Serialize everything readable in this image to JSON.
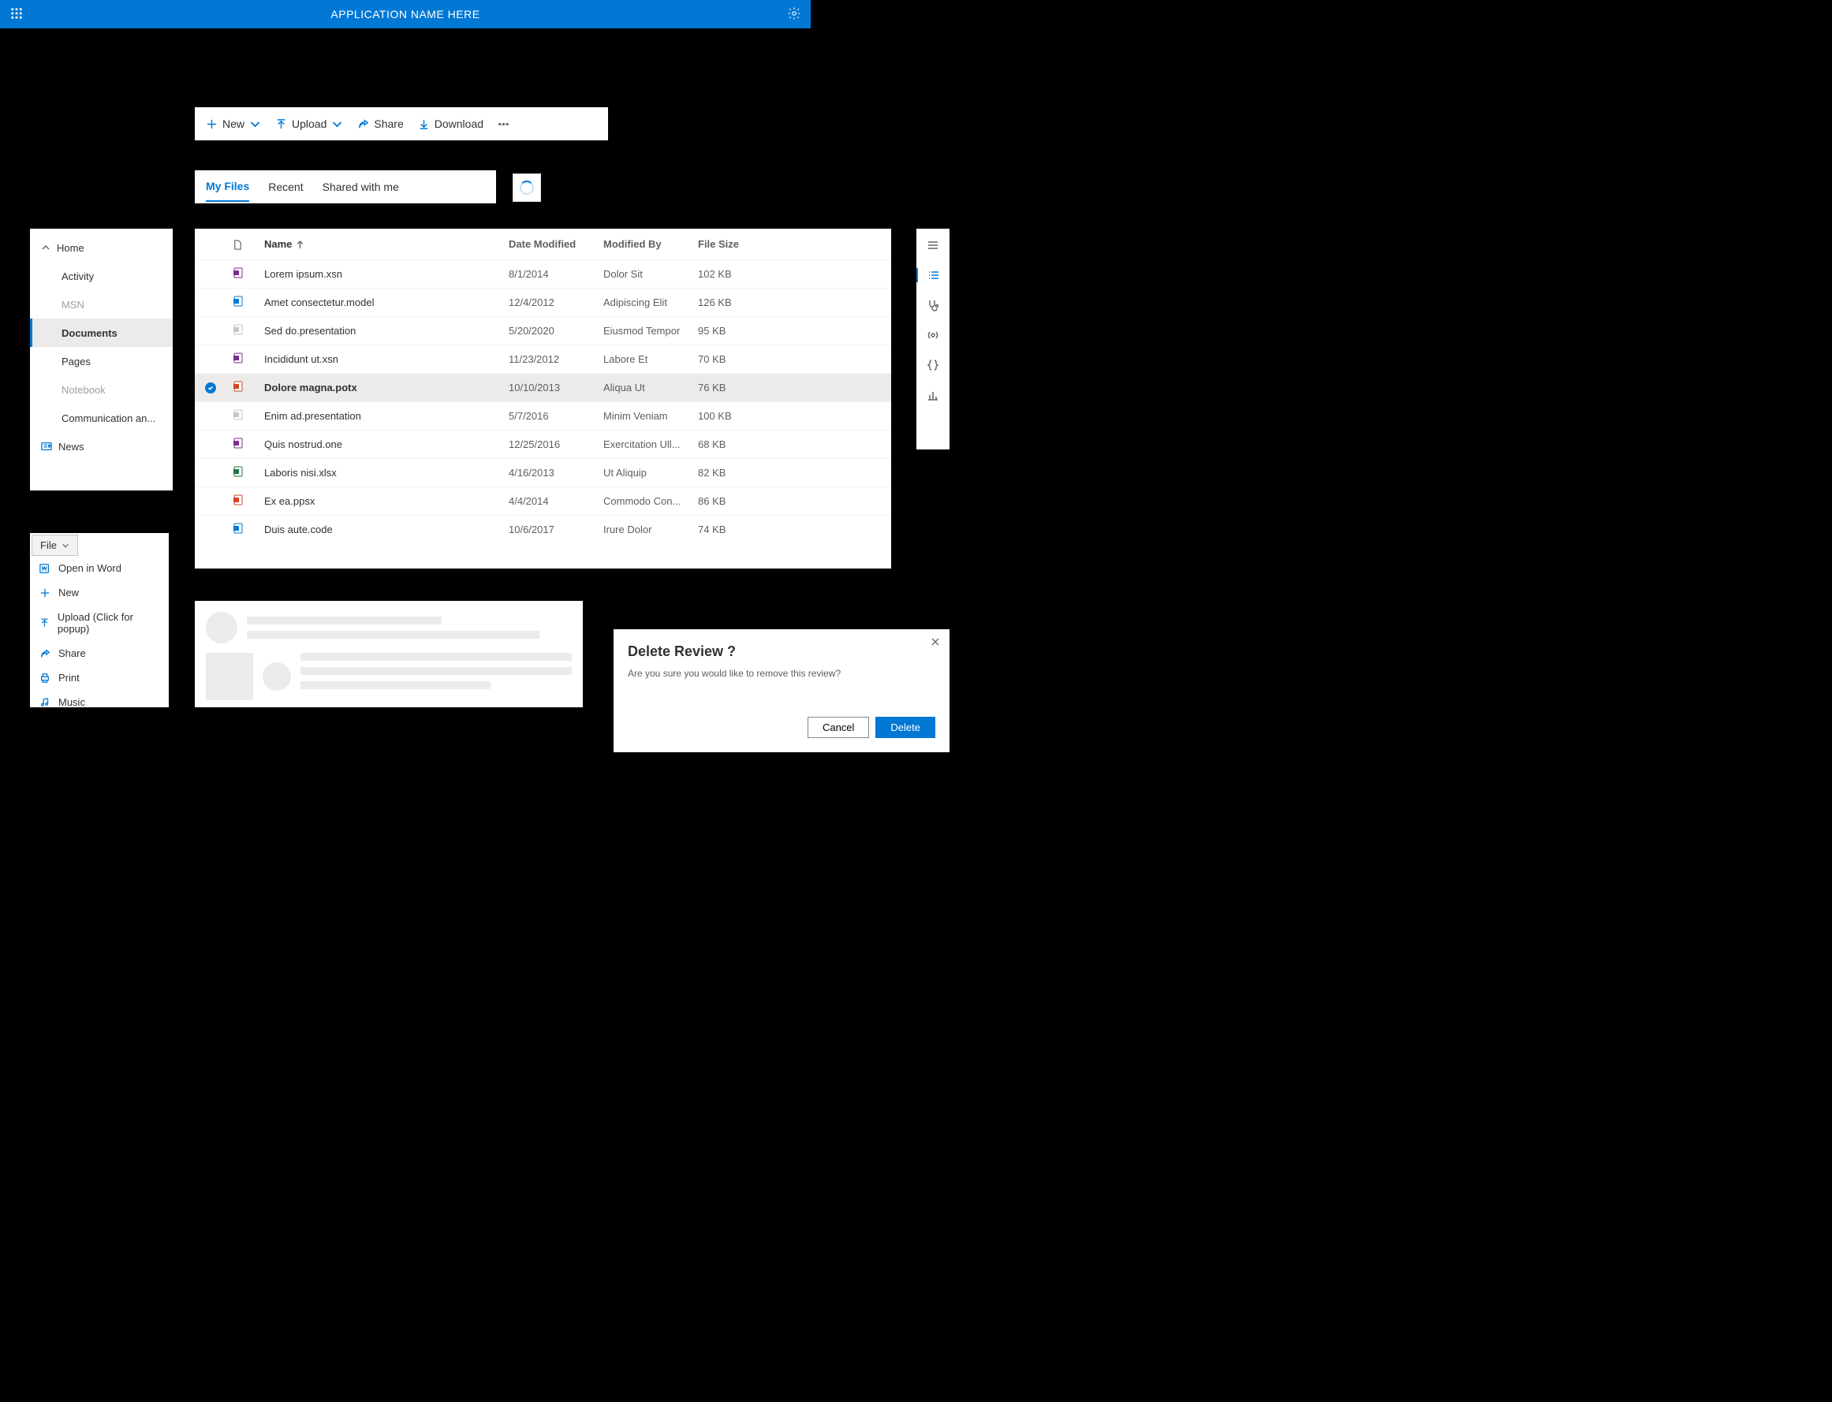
{
  "header": {
    "title": "APPLICATION NAME HERE"
  },
  "commandbar": {
    "new": "New",
    "upload": "Upload",
    "share": "Share",
    "download": "Download"
  },
  "tabs": {
    "t0": "My Files",
    "t1": "Recent",
    "t2": "Shared with me",
    "active": 0
  },
  "nav": {
    "home": "Home",
    "items": [
      {
        "label": "Activity"
      },
      {
        "label": "MSN",
        "muted": true
      },
      {
        "label": "Documents",
        "selected": true
      },
      {
        "label": "Pages"
      },
      {
        "label": "Notebook",
        "muted": true
      },
      {
        "label": "Communication an..."
      }
    ],
    "news": "News"
  },
  "detailsList": {
    "columns": {
      "name": "Name",
      "modified": "Date Modified",
      "by": "Modified By",
      "size": "File Size"
    },
    "rows": [
      {
        "icon": "infopath",
        "name": "Lorem ipsum.xsn",
        "modified": "8/1/2014",
        "by": "Dolor Sit",
        "size": "102 KB"
      },
      {
        "icon": "model",
        "name": "Amet consectetur.model",
        "modified": "12/4/2012",
        "by": "Adipiscing Elit",
        "size": "126 KB"
      },
      {
        "icon": "presentation",
        "name": "Sed do.presentation",
        "modified": "5/20/2020",
        "by": "Eiusmod Tempor",
        "size": "95 KB"
      },
      {
        "icon": "infopath",
        "name": "Incididunt ut.xsn",
        "modified": "11/23/2012",
        "by": "Labore Et",
        "size": "70 KB"
      },
      {
        "icon": "powerpoint",
        "name": "Dolore magna.potx",
        "modified": "10/10/2013",
        "by": "Aliqua Ut",
        "size": "76 KB",
        "selected": true
      },
      {
        "icon": "presentation",
        "name": "Enim ad.presentation",
        "modified": "5/7/2016",
        "by": "Minim Veniam",
        "size": "100 KB"
      },
      {
        "icon": "onenote",
        "name": "Quis nostrud.one",
        "modified": "12/25/2016",
        "by": "Exercitation Ull...",
        "size": "68 KB"
      },
      {
        "icon": "excel",
        "name": "Laboris nisi.xlsx",
        "modified": "4/16/2013",
        "by": "Ut Aliquip",
        "size": "82 KB"
      },
      {
        "icon": "powerpoint-show",
        "name": "Ex ea.ppsx",
        "modified": "4/4/2014",
        "by": "Commodo Con...",
        "size": "86 KB"
      },
      {
        "icon": "code",
        "name": "Duis aute.code",
        "modified": "10/6/2017",
        "by": "Irure Dolor",
        "size": "74 KB"
      }
    ]
  },
  "fileMenu": {
    "header": "File",
    "items": [
      {
        "icon": "word",
        "label": "Open in Word"
      },
      {
        "icon": "plus",
        "label": "New"
      },
      {
        "icon": "upload",
        "label": "Upload (Click for popup)"
      },
      {
        "icon": "share",
        "label": "Share"
      },
      {
        "icon": "print",
        "label": "Print"
      },
      {
        "icon": "music",
        "label": "Music"
      }
    ]
  },
  "dialog": {
    "title": "Delete Review ?",
    "body": "Are you sure you would like to remove this review?",
    "cancel": "Cancel",
    "confirm": "Delete"
  },
  "fileIconColors": {
    "infopath": "#7b2e8c",
    "model": "#0078d4",
    "presentation": "#c8c6c4",
    "powerpoint": "#d24726",
    "onenote": "#7b2e8c",
    "excel": "#217346",
    "powerpoint-show": "#d24726",
    "code": "#0078d4",
    "word": "#2b579a"
  }
}
